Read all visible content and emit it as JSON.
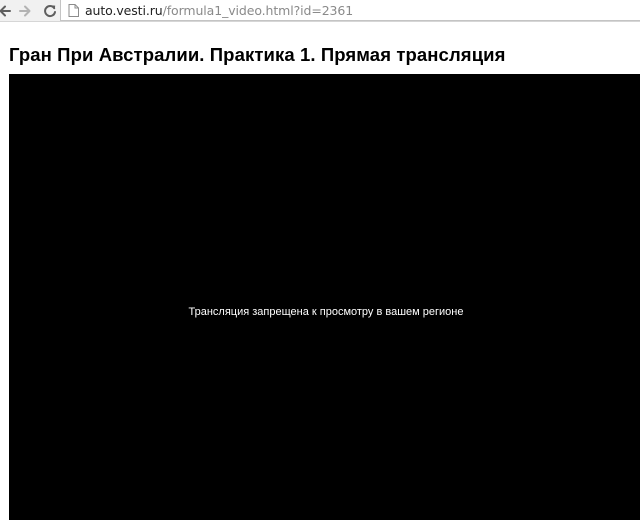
{
  "browser": {
    "url_host": "auto.vesti.ru",
    "url_path": "/formula1_video.html?id=2361",
    "icons": {
      "back": "arrow-left-icon",
      "forward": "arrow-right-icon",
      "reload": "reload-icon",
      "page": "page-icon"
    }
  },
  "page": {
    "title": "Гран При Австралии. Практика 1. Прямая трансляция",
    "player": {
      "message": "Трансляция запрещена к просмотру в вашем регионе",
      "background": "#000000"
    }
  }
}
